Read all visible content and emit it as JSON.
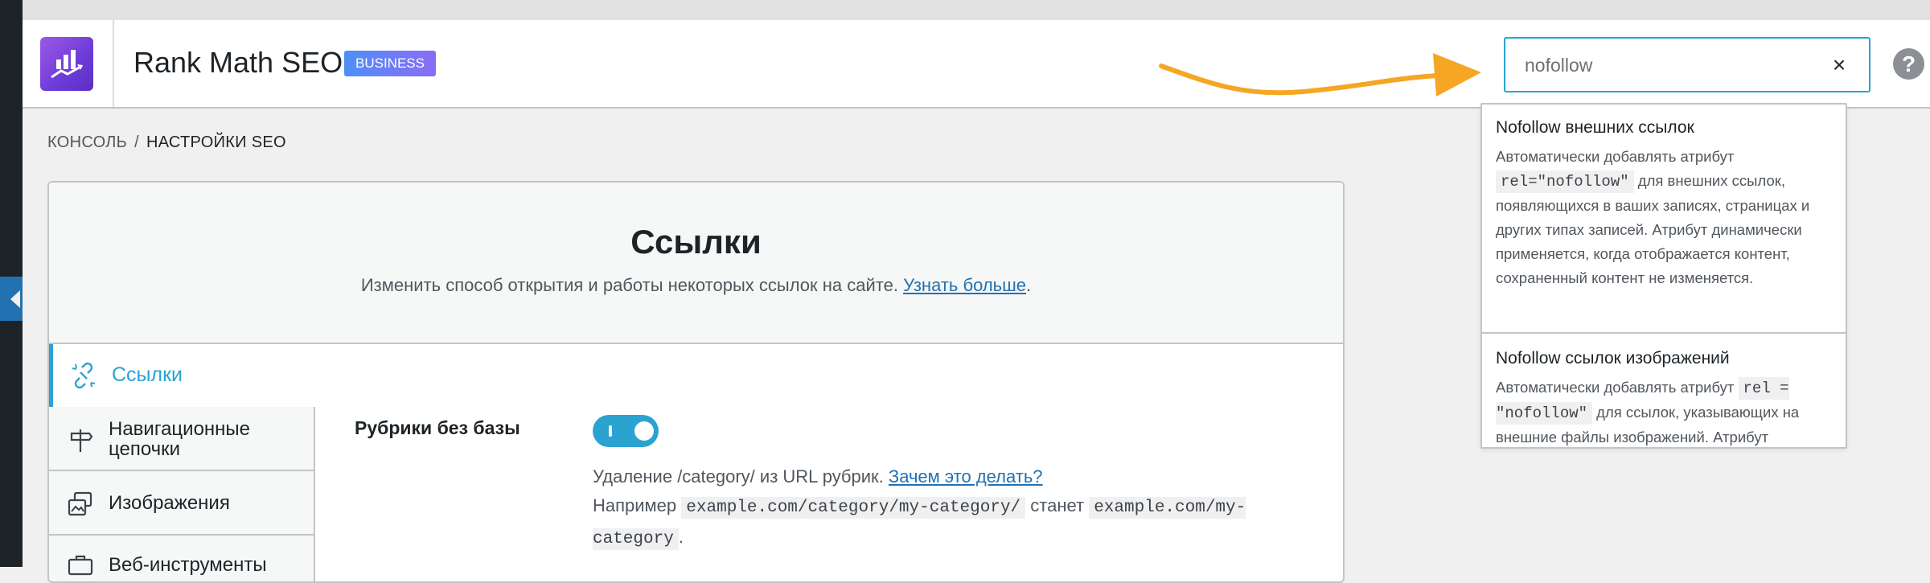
{
  "header": {
    "brand": "Rank Math SEO",
    "badge": "BUSINESS",
    "search": {
      "value": "nofollow",
      "clear_label": "×"
    },
    "help_label": "?"
  },
  "breadcrumb": {
    "root": "КОНСОЛЬ",
    "separator": "/",
    "current": "НАСТРОЙКИ SEO"
  },
  "panel": {
    "title": "Ссылки",
    "subtitle": "Изменить способ открытия и работы некоторых ссылок на сайте.",
    "learn_more": "Узнать больше",
    "subtitle_end": "."
  },
  "nav": {
    "active": "Ссылки",
    "items": [
      {
        "label": "Навигационные цепочки"
      },
      {
        "label": "Изображения"
      },
      {
        "label": "Веб-инструменты"
      }
    ]
  },
  "setting": {
    "label": "Рубрики без базы",
    "enabled": true,
    "desc_1": "Удаление /category/ из URL рубрик.",
    "why_link": "Зачем это делать?",
    "desc_2": "Например",
    "code_1": "example.com/category/my-category/",
    "desc_3": "станет",
    "code_2": "example.com/my-category",
    "desc_end": "."
  },
  "search_results": [
    {
      "title": "Nofollow внешних ссылок",
      "desc_before": "Автоматически добавлять атрибут",
      "code": "rel=\"nofollow\"",
      "desc_after": "для внешних ссылок, появляющихся в ваших записях, страницах и других типах записей. Атрибут динамически применяется, когда отображается контент, сохраненный контент не изменяется."
    },
    {
      "title": "Nofollow ссылок изображений",
      "desc_before": "Автоматически добавлять атрибут",
      "code": "rel = \"nofollow\"",
      "desc_after": "для ссылок, указывающих на внешние файлы изображений. Атрибут динамически применяется, когда отображается контент."
    }
  ],
  "colors": {
    "accent": "#2aa3d1",
    "arrow": "#f5a623",
    "logo": "#7b44dd",
    "link": "#2271b1"
  }
}
